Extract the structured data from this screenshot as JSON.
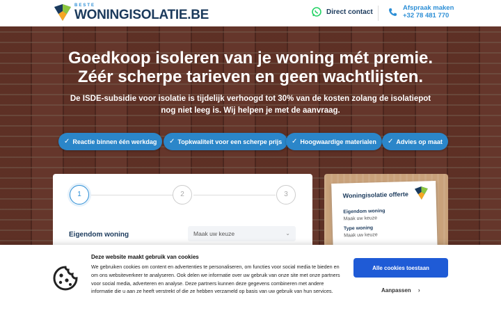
{
  "header": {
    "logo_small": "BESTE",
    "logo_big": "WONINGISOLATIE.BE",
    "contact_label": "Direct contact",
    "afspraak_label": "Afspraak maken",
    "afspraak_phone": "+32 78 481 770"
  },
  "hero": {
    "title_line1": "Goedkoop isoleren van je woning mét premie.",
    "title_line2": "Zéér scherpe tarieven en geen wachtlijsten.",
    "lead": "De ISDE-subsidie voor isolatie is tijdelijk verhoogd tot 30% van de kosten zolang de isolatiepot nog niet leeg is. Wij helpen je met de aanvraag.",
    "pills": [
      "Reactie binnen één werkdag",
      "Topkwaliteit voor een scherpe prijs",
      "Hoogwaardige materialen",
      "Advies op maat"
    ]
  },
  "form": {
    "steps": [
      "1",
      "2",
      "3"
    ],
    "field_label": "Eigendom woning",
    "select_value": "Maak uw keuze"
  },
  "quote": {
    "title": "Woningisolatie offerte",
    "rows": [
      {
        "label": "Eigendom woning",
        "value": "Maak uw keuze"
      },
      {
        "label": "Type woning",
        "value": "Maak uw keuze"
      }
    ]
  },
  "cookie": {
    "title": "Deze website maakt gebruik van cookies",
    "text": "We gebruiken cookies om content en advertenties te personaliseren, om functies voor social media te bieden en om ons websiteverkeer te analyseren. Ook delen we informatie over uw gebruik van onze site met onze partners voor social media, adverteren en analyse. Deze partners kunnen deze gegevens combineren met andere informatie die u aan ze heeft verstrekt of die ze hebben verzameld op basis van uw gebruik van hun services.",
    "accept_label": "Alle cookies toestaan",
    "customize_label": "Aanpassen"
  },
  "colors": {
    "brand_blue": "#2d8fd6",
    "navy": "#1b3a5c",
    "pill_blue": "#2b86c9",
    "accept_blue": "#1f5bd6",
    "whatsapp_green": "#25d366"
  }
}
